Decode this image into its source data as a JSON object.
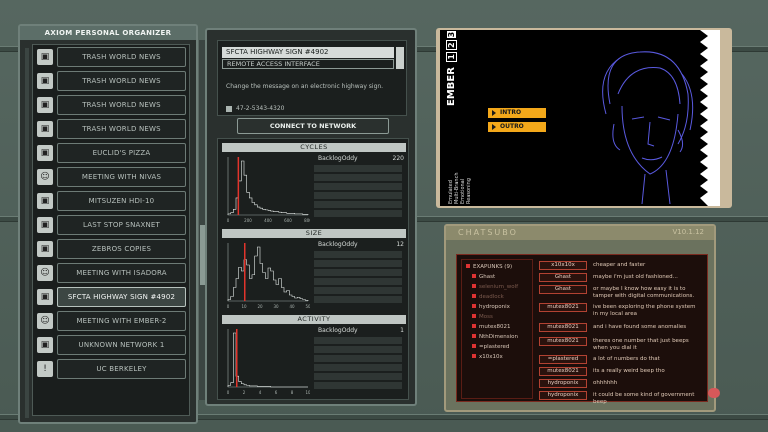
{
  "organizer": {
    "title": "AXIOM PERSONAL ORGANIZER",
    "items": [
      {
        "label": "TRASH WORLD NEWS",
        "icon": "group-icon"
      },
      {
        "label": "TRASH WORLD NEWS",
        "icon": "group-icon"
      },
      {
        "label": "TRASH WORLD NEWS",
        "icon": "group-icon"
      },
      {
        "label": "TRASH WORLD NEWS",
        "icon": "group-icon"
      },
      {
        "label": "EUCLID'S PIZZA",
        "icon": "group-icon"
      },
      {
        "label": "MEETING WITH NIVAS",
        "icon": "person-icon"
      },
      {
        "label": "MITSUZEN HDI-10",
        "icon": "group-icon"
      },
      {
        "label": "LAST STOP SNAXNET",
        "icon": "group-icon"
      },
      {
        "label": "ZEBROS COPIES",
        "icon": "group-icon"
      },
      {
        "label": "MEETING WITH ISADORA",
        "icon": "person-icon"
      },
      {
        "label": "SFCTA HIGHWAY SIGN #4902",
        "icon": "group-icon",
        "selected": true
      },
      {
        "label": "MEETING WITH EMBER-2",
        "icon": "person-icon"
      },
      {
        "label": "UNKNOWN NETWORK 1",
        "icon": "group-icon"
      },
      {
        "label": "UC BERKELEY",
        "icon": "alert-icon"
      }
    ]
  },
  "detail": {
    "title": "SFCTA HIGHWAY SIGN #4902",
    "subtitle": "REMOTE ACCESS INTERFACE",
    "description": "Change the message on an electronic highway sign.",
    "phone": "47-2-5343-4320",
    "connect_label": "CONNECT TO NETWORK"
  },
  "graphs": [
    {
      "title": "CYCLES",
      "user": "BacklogOddy",
      "value": "220",
      "ticks": [
        "0",
        "200",
        "400",
        "600",
        "800"
      ],
      "bars": [
        2,
        4,
        10,
        30,
        60,
        95,
        70,
        40,
        30,
        22,
        18,
        14,
        12,
        10,
        9,
        8,
        7,
        6,
        6,
        5,
        4,
        4,
        3,
        3,
        3,
        2,
        2,
        2,
        1,
        1
      ],
      "marker": 0.12
    },
    {
      "title": "SIZE",
      "user": "BacklogOddy",
      "value": "12",
      "ticks": [
        "0",
        "10",
        "20",
        "30",
        "40",
        "50"
      ],
      "bars": [
        2,
        6,
        18,
        30,
        45,
        40,
        55,
        48,
        30,
        35,
        60,
        72,
        50,
        38,
        30,
        44,
        40,
        28,
        22,
        30,
        18,
        12,
        14,
        8,
        6,
        4,
        5,
        3,
        2,
        1
      ],
      "marker": 0.2
    },
    {
      "title": "ACTIVITY",
      "user": "BacklogOddy",
      "value": "1",
      "ticks": [
        "0",
        "2",
        "4",
        "6",
        "8",
        "10"
      ],
      "bars": [
        3,
        8,
        100,
        20,
        10,
        6,
        4,
        3,
        2,
        2,
        2,
        1,
        1,
        1,
        1,
        1,
        0,
        0,
        0,
        0,
        0,
        0,
        0,
        0,
        0,
        0,
        0,
        0,
        0,
        0
      ],
      "marker": 0.1
    }
  ],
  "ember": {
    "name": "EMBER",
    "digits": [
      "1",
      "2",
      "3"
    ],
    "intro": "INTRO",
    "outro": "OUTRO",
    "tags": [
      "Emulated",
      "Multi-Branch",
      "Emotional",
      "Reasoning"
    ]
  },
  "chat": {
    "title": "CHATSUBO",
    "version": "V10.1.12",
    "channels": [
      {
        "name": "EXAPUNKS (9)",
        "indent": 0,
        "dim": false
      },
      {
        "name": "Ghast",
        "indent": 1,
        "dim": false
      },
      {
        "name": "selenium_wolf",
        "indent": 1,
        "dim": true
      },
      {
        "name": "deadlock",
        "indent": 1,
        "dim": true
      },
      {
        "name": "hydroponix",
        "indent": 1,
        "dim": false
      },
      {
        "name": "Moss",
        "indent": 1,
        "dim": true
      },
      {
        "name": "mutex8021",
        "indent": 1,
        "dim": false
      },
      {
        "name": "NthDimension",
        "indent": 1,
        "dim": false
      },
      {
        "name": "=plastered",
        "indent": 1,
        "dim": false
      },
      {
        "name": "x10x10x",
        "indent": 1,
        "dim": false
      }
    ],
    "messages": [
      {
        "nick": "x10x10x",
        "text": "cheaper and faster"
      },
      {
        "nick": "Ghast",
        "text": "maybe i'm just old fashioned..."
      },
      {
        "nick": "Ghast",
        "text": "or maybe I know how easy it is to tamper with digital communications."
      },
      {
        "nick": "mutex8021",
        "text": "ive been exploring the phone system in my local area"
      },
      {
        "nick": "mutex8021",
        "text": "and i have found some anomalies"
      },
      {
        "nick": "mutex8021",
        "text": "theres one number that just beeps when you dial it"
      },
      {
        "nick": "=plastered",
        "text": "a lot of numbers do that"
      },
      {
        "nick": "mutex8021",
        "text": "its a really weird beep tho"
      },
      {
        "nick": "hydroponix",
        "text": "ohhhhhh"
      },
      {
        "nick": "hydroponix",
        "text": "it could be some kind of government beep"
      }
    ]
  }
}
